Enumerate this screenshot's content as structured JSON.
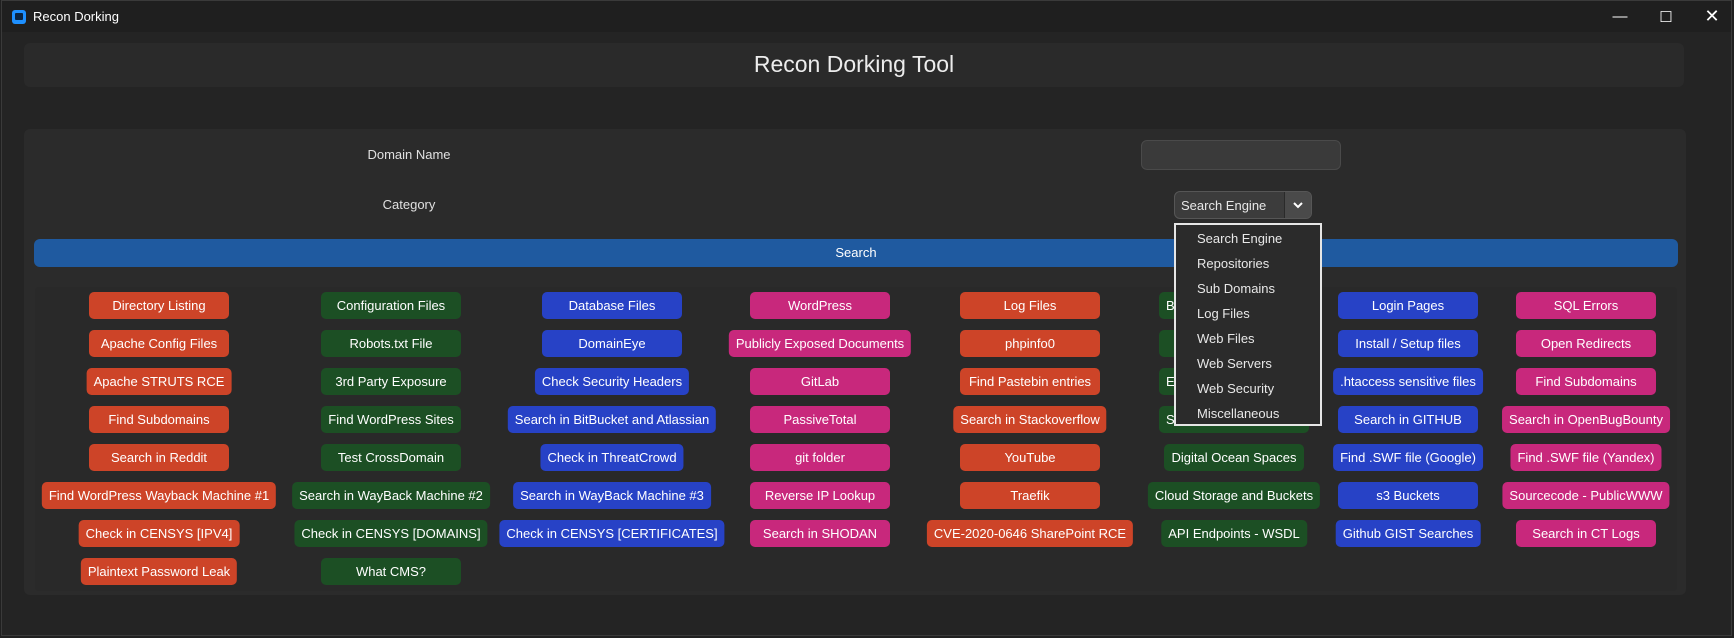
{
  "window": {
    "title": "Recon Dorking"
  },
  "header": {
    "title": "Recon Dorking Tool"
  },
  "form": {
    "domain_label": "Domain Name",
    "domain_value": "",
    "category_label": "Category",
    "category_value": "Search Engine",
    "category_options": [
      "Search Engine",
      "Repositories",
      "Sub Domains",
      "Log Files",
      "Web Files",
      "Web Servers",
      "Web Security",
      "Miscellaneous"
    ],
    "search_label": "Search"
  },
  "colors": {
    "orange": "#cd4428",
    "green": "#1c4f24",
    "blue": "#2742c6",
    "pink": "#c8287c",
    "search": "#1f5aa0"
  },
  "dork_columns": [
    {
      "color": "orange",
      "items": [
        "Directory Listing",
        "Apache Config Files",
        "Apache STRUTS RCE",
        "Find Subdomains",
        "Search in Reddit",
        "Find WordPress Wayback Machine #1",
        "Check in CENSYS [IPV4]",
        "Plaintext Password Leak"
      ]
    },
    {
      "color": "green",
      "items": [
        "Configuration Files",
        "Robots.txt File",
        "3rd Party Exposure",
        "Find WordPress Sites",
        "Test CrossDomain",
        "Search in WayBack Machine #2",
        "Check in CENSYS [DOMAINS]",
        "What CMS?"
      ]
    },
    {
      "color": "blue",
      "items": [
        "Database Files",
        "DomainEye",
        "Check Security Headers",
        "Search in BitBucket and Atlassian",
        "Check in ThreatCrowd",
        "Search in WayBack Machine #3",
        "Check in CENSYS [CERTIFICATES]"
      ]
    },
    {
      "color": "pink",
      "items": [
        "WordPress",
        "Publicly Exposed Documents",
        "GitLab",
        "PassiveTotal",
        "git folder",
        "Reverse IP Lookup",
        "Search in SHODAN"
      ]
    },
    {
      "color": "orange",
      "items": [
        "Log Files",
        "phpinfo0",
        "Find Pastebin entries",
        "Search in Stackoverflow",
        "YouTube",
        "Traefik",
        "CVE-2020-0646 SharePoint RCE"
      ]
    },
    {
      "color": "green",
      "items": [
        "B",
        "",
        "En",
        "Se",
        "Digital Ocean Spaces",
        "Cloud Storage and Buckets",
        "API Endpoints - WSDL"
      ]
    },
    {
      "color": "blue",
      "items": [
        "Login Pages",
        "Install / Setup files",
        ".htaccess sensitive files",
        "Search in GITHUB",
        "Find .SWF file (Google)",
        "s3 Buckets",
        "Github GIST Searches"
      ]
    },
    {
      "color": "pink",
      "items": [
        "SQL Errors",
        "Open Redirects",
        "Find Subdomains",
        "Search in OpenBugBounty",
        "Find .SWF file (Yandex)",
        "Sourcecode - PublicWWW",
        "Search in CT Logs"
      ]
    }
  ]
}
